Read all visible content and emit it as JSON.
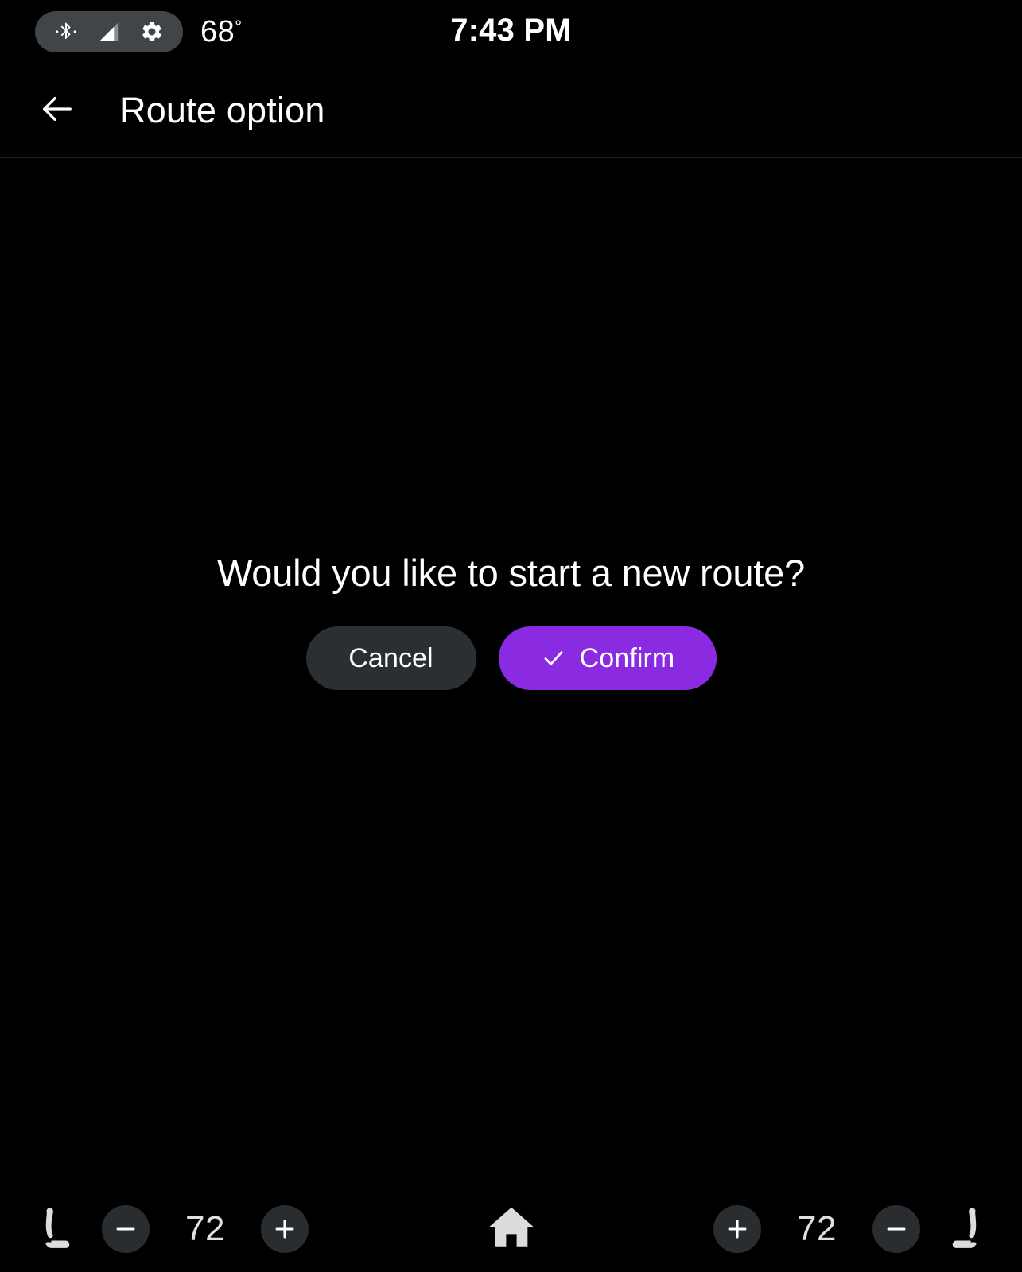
{
  "status_bar": {
    "bluetooth_icon": "bluetooth-icon",
    "signal_icon": "signal-bars-icon",
    "settings_icon": "gear-icon",
    "temperature": "68",
    "degree_symbol": "°",
    "clock": "7:43 PM"
  },
  "header": {
    "back_icon": "back-arrow-icon",
    "title": "Route option"
  },
  "dialog": {
    "message": "Would you like to start a new route?",
    "cancel_label": "Cancel",
    "confirm_label": "Confirm",
    "confirm_icon": "check-icon",
    "confirm_color": "#8a2be2",
    "cancel_color": "#2b2e33"
  },
  "bottom_bar": {
    "left_climate": {
      "seat_icon": "seat-heater-icon",
      "decrease_label": "−",
      "temperature": "72",
      "increase_label": "+"
    },
    "home_icon": "home-icon",
    "right_climate": {
      "increase_label": "+",
      "temperature": "72",
      "decrease_label": "−",
      "seat_icon": "seat-heater-icon"
    }
  }
}
